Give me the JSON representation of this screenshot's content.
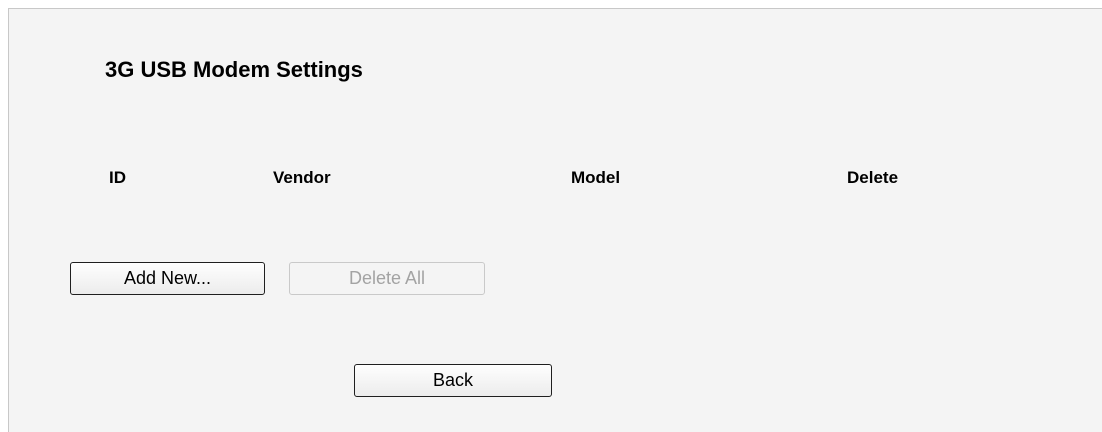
{
  "page": {
    "title": "3G USB Modem Settings"
  },
  "table": {
    "columns": [
      "ID",
      "Vendor",
      "Model",
      "Delete"
    ],
    "rows": []
  },
  "buttons": {
    "add_new": "Add New...",
    "delete_all": "Delete All",
    "back": "Back"
  }
}
